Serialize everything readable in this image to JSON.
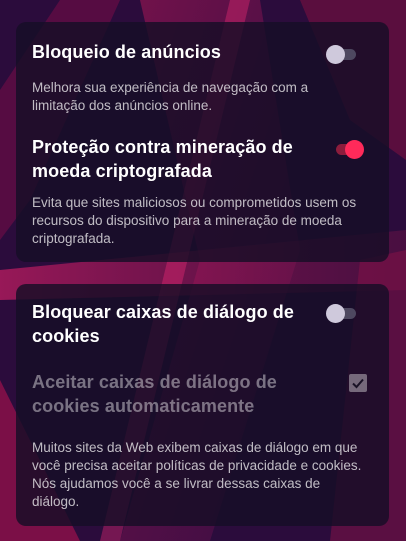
{
  "section1": {
    "ad_block": {
      "title": "Bloqueio de anúncios",
      "description": "Melhora sua experiência de navegação com a limitação dos anúncios online.",
      "enabled": false
    },
    "crypto": {
      "title": "Proteção contra mineração de moeda criptografada",
      "description": "Evita que sites maliciosos ou comprometidos usem os recursos do dispositivo para a mineração de moeda criptografada.",
      "enabled": true
    }
  },
  "section2": {
    "cookie_block": {
      "title": "Bloquear caixas de diálogo de cookies",
      "enabled": false
    },
    "cookie_accept": {
      "title": "Aceitar caixas de diálogo de cookies automaticamente",
      "checked": true,
      "disabled": true
    },
    "description": "Muitos sites da Web exibem caixas de diálogo em que você precisa aceitar políticas de privacidade e cookies. Nós ajudamos você a se livrar dessas caixas de diálogo."
  },
  "colors": {
    "accent": "#ff2a5a",
    "card_background": "#160e26",
    "toggle_off_thumb": "#cfc9dc"
  }
}
